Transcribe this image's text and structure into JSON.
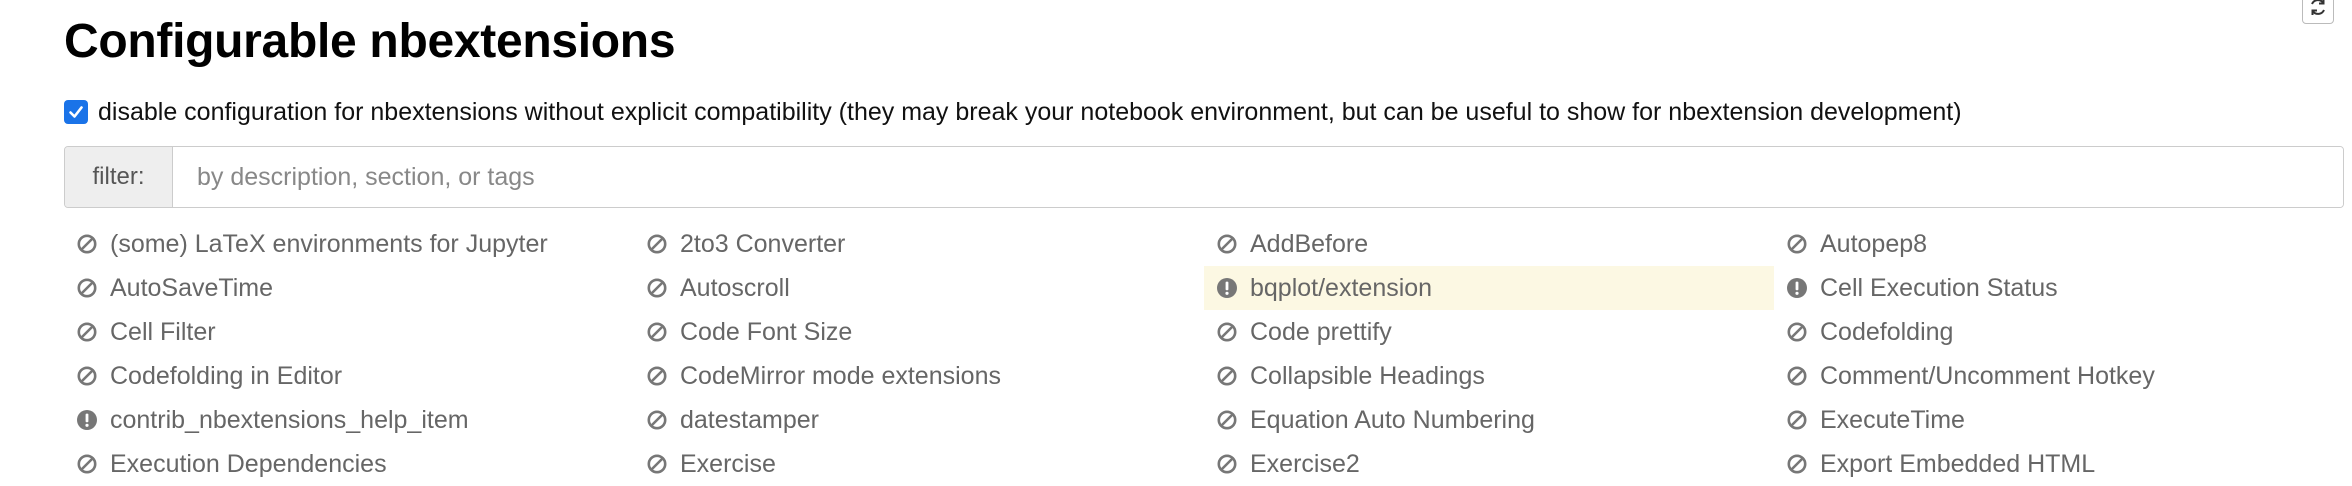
{
  "page": {
    "title": "Configurable nbextensions"
  },
  "compat": {
    "checked": true,
    "label": "disable configuration for nbextensions without explicit compatibility (they may break your notebook environment, but can be useful to show for nbextension development)"
  },
  "filter": {
    "label": "filter:",
    "placeholder": "by description, section, or tags",
    "value": ""
  },
  "toolbar": {
    "refresh_icon": "refresh-icon"
  },
  "extensions": [
    {
      "label": "(some) LaTeX environments for Jupyter",
      "status": "disabled",
      "highlighted": false
    },
    {
      "label": "2to3 Converter",
      "status": "disabled",
      "highlighted": false
    },
    {
      "label": "AddBefore",
      "status": "disabled",
      "highlighted": false
    },
    {
      "label": "Autopep8",
      "status": "disabled",
      "highlighted": false
    },
    {
      "label": "AutoSaveTime",
      "status": "disabled",
      "highlighted": false
    },
    {
      "label": "Autoscroll",
      "status": "disabled",
      "highlighted": false
    },
    {
      "label": "bqplot/extension",
      "status": "warning",
      "highlighted": true
    },
    {
      "label": "Cell Execution Status",
      "status": "warning",
      "highlighted": false
    },
    {
      "label": "Cell Filter",
      "status": "disabled",
      "highlighted": false
    },
    {
      "label": "Code Font Size",
      "status": "disabled",
      "highlighted": false
    },
    {
      "label": "Code prettify",
      "status": "disabled",
      "highlighted": false
    },
    {
      "label": "Codefolding",
      "status": "disabled",
      "highlighted": false
    },
    {
      "label": "Codefolding in Editor",
      "status": "disabled",
      "highlighted": false
    },
    {
      "label": "CodeMirror mode extensions",
      "status": "disabled",
      "highlighted": false
    },
    {
      "label": "Collapsible Headings",
      "status": "disabled",
      "highlighted": false
    },
    {
      "label": "Comment/Uncomment Hotkey",
      "status": "disabled",
      "highlighted": false
    },
    {
      "label": "contrib_nbextensions_help_item",
      "status": "warning",
      "highlighted": false
    },
    {
      "label": "datestamper",
      "status": "disabled",
      "highlighted": false
    },
    {
      "label": "Equation Auto Numbering",
      "status": "disabled",
      "highlighted": false
    },
    {
      "label": "ExecuteTime",
      "status": "disabled",
      "highlighted": false
    },
    {
      "label": "Execution Dependencies",
      "status": "disabled",
      "highlighted": false
    },
    {
      "label": "Exercise",
      "status": "disabled",
      "highlighted": false
    },
    {
      "label": "Exercise2",
      "status": "disabled",
      "highlighted": false
    },
    {
      "label": "Export Embedded HTML",
      "status": "disabled",
      "highlighted": false
    }
  ],
  "colors": {
    "checkbox": "#1a73e8",
    "highlight": "#fcf8e3",
    "icon": "#777777",
    "warning_icon": "#777777"
  }
}
